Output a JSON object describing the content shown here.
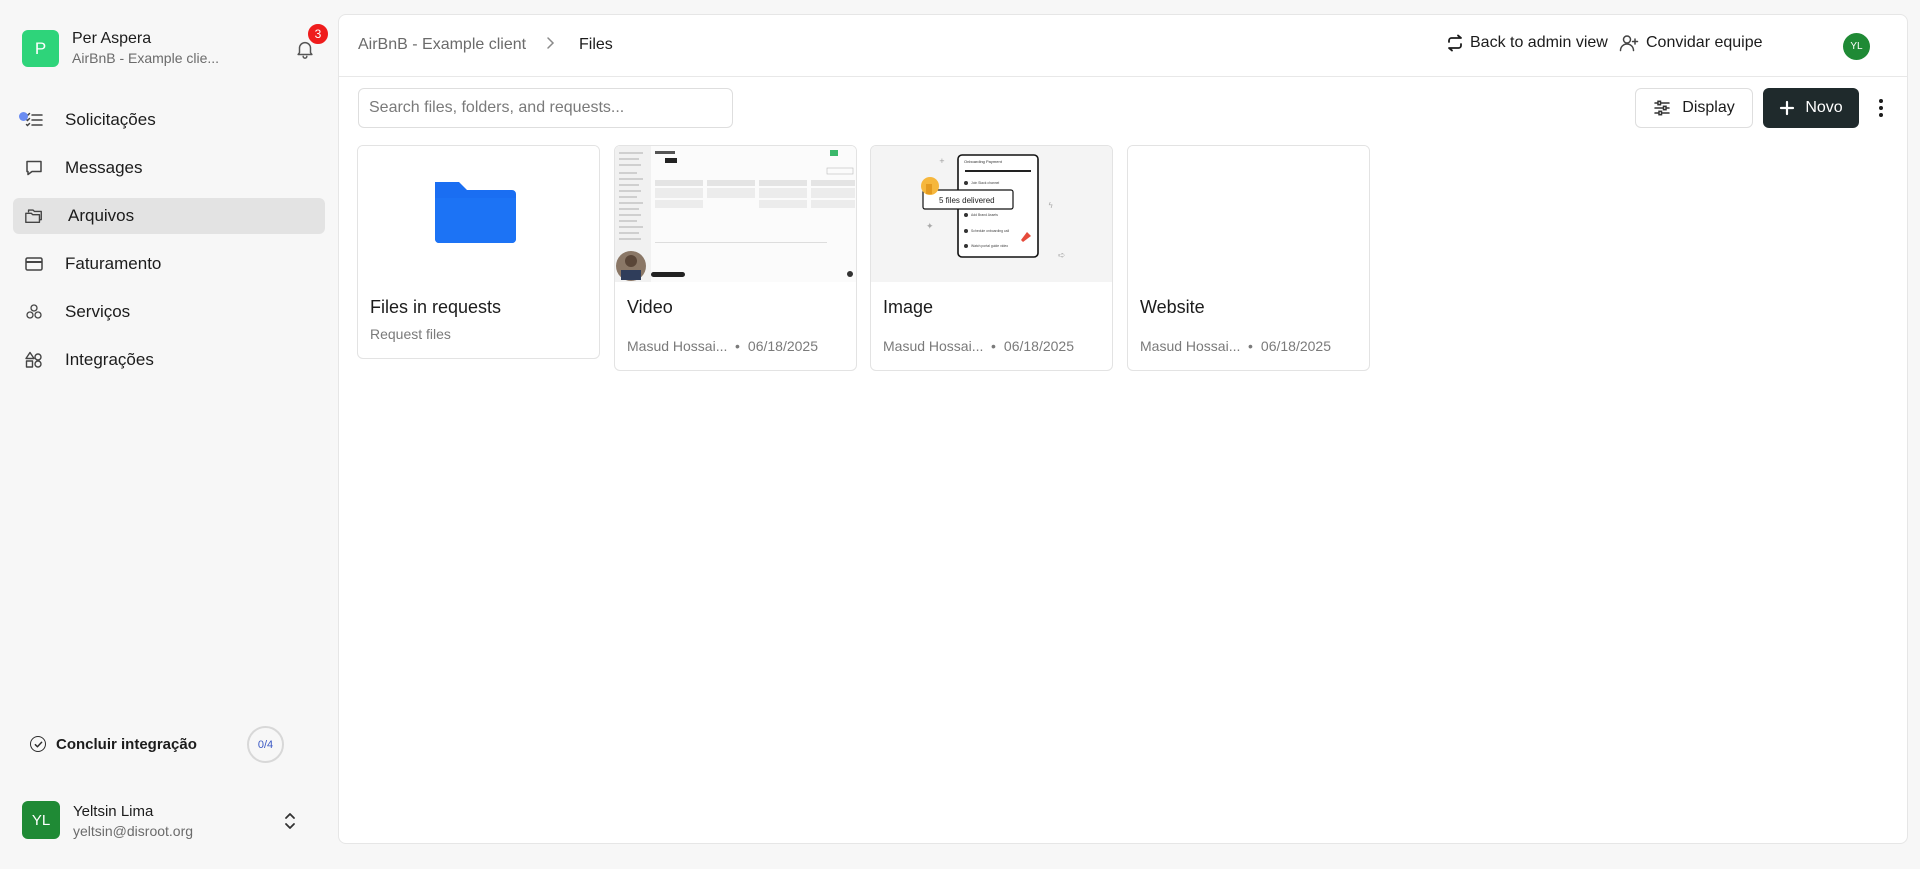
{
  "workspace": {
    "logo": "P",
    "name": "Per Aspera",
    "client": "AirBnB - Example clie..."
  },
  "notifications": {
    "count": "3",
    "icon": "bell-icon"
  },
  "nav": {
    "items": [
      {
        "label": "Solicitações",
        "icon": "list-icon"
      },
      {
        "label": "Messages",
        "icon": "message-icon"
      },
      {
        "label": "Arquivos",
        "icon": "folders-icon",
        "active": true
      },
      {
        "label": "Faturamento",
        "icon": "credit-card-icon"
      },
      {
        "label": "Serviços",
        "icon": "services-icon"
      },
      {
        "label": "Integrações",
        "icon": "shapes-icon"
      }
    ]
  },
  "onboarding": {
    "label": "Concluir integração",
    "progress": "0/4"
  },
  "user": {
    "initials": "YL",
    "name": "Yeltsin Lima",
    "email": "yeltsin@disroot.org"
  },
  "header": {
    "breadcrumb": [
      "AirBnB - Example client",
      "Files"
    ],
    "back_label": "Back to admin view",
    "invite_label": "Convidar equipe",
    "avatar": "YL"
  },
  "toolbar": {
    "search_placeholder": "Search files, folders, and requests...",
    "display_label": "Display",
    "new_label": "Novo"
  },
  "cards": [
    {
      "title": "Files in requests",
      "subtitle": "Request files",
      "thumb": "folder-icon",
      "color": "#1a6ef2"
    },
    {
      "title": "Video",
      "author": "Masud Hossai...",
      "date": "06/18/2025",
      "thumb": "video-thumbnail"
    },
    {
      "title": "Image",
      "author": "Masud Hossai...",
      "date": "06/18/2025",
      "thumb": "image-thumbnail",
      "thumb_text": {
        "heading": "Onboarding Payment",
        "badge": "5 files delivered",
        "checklist": [
          "Join Slack channel",
          "Add Brand Assets",
          "Schedule onboarding call",
          "Watch portal guide video"
        ]
      }
    },
    {
      "title": "Website",
      "author": "Masud Hossai...",
      "date": "06/18/2025",
      "thumb": "blank-thumbnail"
    }
  ],
  "colors": {
    "accent": "#1f2a2c",
    "workspace_logo": "#2ed47a",
    "avatar": "#1f8a35",
    "badge": "#ef1c1c",
    "folder": "#1a6ef2"
  }
}
